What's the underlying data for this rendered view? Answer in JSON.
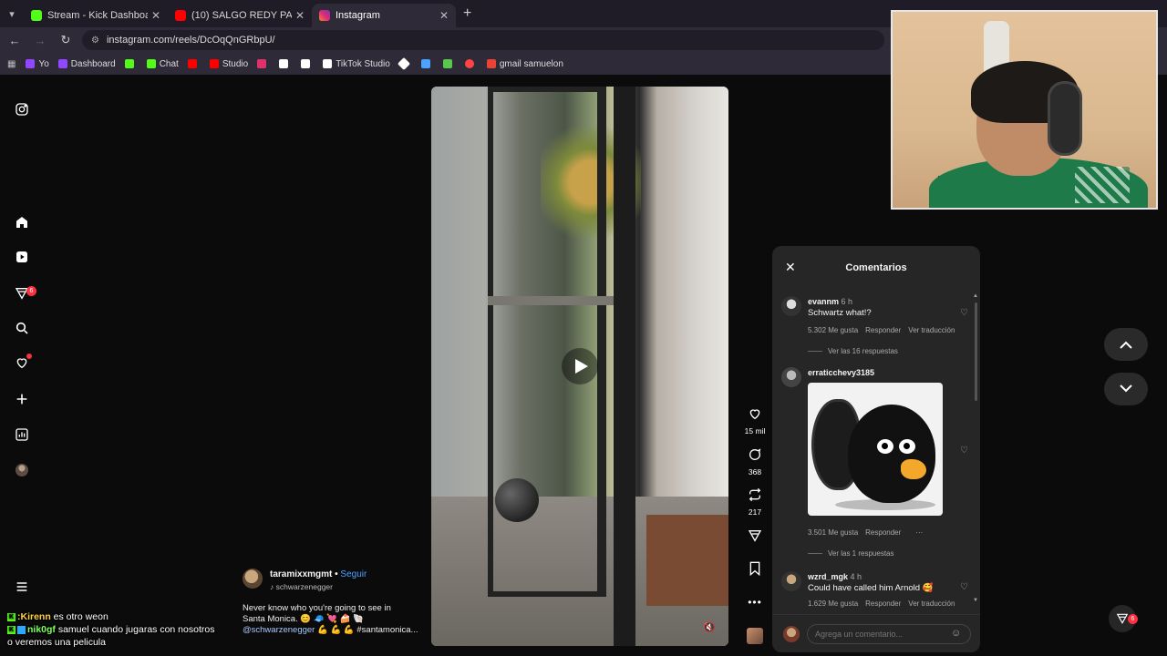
{
  "browser": {
    "tabs": [
      {
        "title": "Stream - Kick Dashboard",
        "favicon_color": "#53fc18",
        "active": false
      },
      {
        "title": "(10) SALGO REDY PA LA STREET",
        "favicon_color": "#ff0000",
        "active": false
      },
      {
        "title": "Instagram",
        "favicon_color": "#e1306c",
        "active": true
      }
    ],
    "url": "instagram.com/reels/DcOqQnGRbpU/",
    "bookmarks": [
      {
        "label": "Yo",
        "color": "#9146ff"
      },
      {
        "label": "Dashboard",
        "color": "#9146ff"
      },
      {
        "label": "",
        "color": "#53fc18"
      },
      {
        "label": "Chat",
        "color": "#53fc18"
      },
      {
        "label": "",
        "color": "#ff0000"
      },
      {
        "label": "Studio",
        "color": "#ff0000"
      },
      {
        "label": "",
        "color": "#e1306c"
      },
      {
        "label": "",
        "color": "#ffffff"
      },
      {
        "label": "",
        "color": "#ffffff"
      },
      {
        "label": "TikTok Studio",
        "color": "#ffffff"
      },
      {
        "label": "",
        "color": "#ffffff"
      },
      {
        "label": "",
        "color": "#4aa3ff"
      },
      {
        "label": "",
        "color": "#57c84d"
      },
      {
        "label": "",
        "color": "#ff4444"
      },
      {
        "label": "gmail samuelon",
        "color": "#ea4335"
      }
    ]
  },
  "rail": {
    "messages_badge": "6"
  },
  "reel": {
    "username": "taramixxmgmt",
    "separator": " • ",
    "follow_label": "Seguir",
    "audio_label": "schwarzenegger",
    "caption_line1": "Never know who you're going to see in",
    "caption_line2": "Santa Monica. 😊 🧢 💘 🍰 🐚",
    "caption_mention": "@schwarzenegger",
    "caption_tail": " 💪 💪 💪 #santamonica..."
  },
  "actions": {
    "likes": "15 mil",
    "comments": "368",
    "reposts": "217"
  },
  "comments_panel": {
    "title": "Comentarios",
    "input_placeholder": "Agrega un comentario...",
    "items": [
      {
        "user": "evannm",
        "time": "6 h",
        "text": "Schwartz what!?",
        "likes": "5.302 Me gusta",
        "reply": "Responder",
        "translate": "Ver traducción",
        "replies": "Ver las 16 respuestas"
      },
      {
        "user": "erraticchevy3185",
        "time": "",
        "text": "",
        "likes": "3.501 Me gusta",
        "reply": "Responder",
        "more": "···",
        "replies": "Ver las 1 respuestas"
      },
      {
        "user": "wzrd_mgk",
        "time": "4 h",
        "text": "Could have called him Arnold 🥰",
        "likes": "1.629 Me gusta",
        "reply": "Responder",
        "translate": "Ver traducción"
      }
    ]
  },
  "fab_badge": "6",
  "chat": [
    {
      "user": ":Kirenn",
      "message": " es otro weon"
    },
    {
      "user": "nik0gf",
      "message": " samuel cuando jugaras con nosotros o veremos una pelicula"
    }
  ]
}
